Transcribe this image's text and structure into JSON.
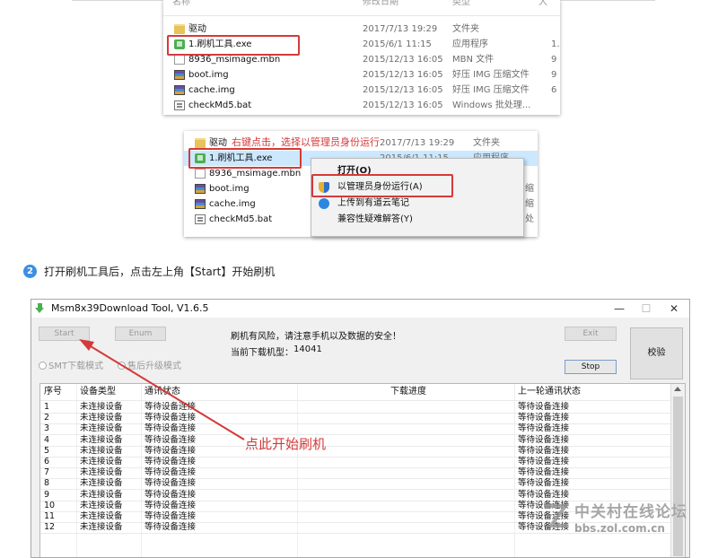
{
  "explorer1": {
    "header": {
      "name": "名称",
      "date": "修改日期",
      "type": "类型",
      "size": "大"
    },
    "rows": [
      {
        "icon": "folder-icon",
        "name": "驱动",
        "date": "2017/7/13 19:29",
        "type": "文件夹",
        "size": ""
      },
      {
        "icon": "exe-icon",
        "name": "1.刷机工具.exe",
        "date": "2015/6/1 11:15",
        "type": "应用程序",
        "size": "1."
      },
      {
        "icon": "file-icon",
        "name": "8936_msimage.mbn",
        "date": "2015/12/13 16:05",
        "type": "MBN 文件",
        "size": "9"
      },
      {
        "icon": "rar-icon",
        "name": "boot.img",
        "date": "2015/12/13 16:05",
        "type": "好压 IMG 压缩文件",
        "size": "9"
      },
      {
        "icon": "rar-icon",
        "name": "cache.img",
        "date": "2015/12/13 16:05",
        "type": "好压 IMG 压缩文件",
        "size": "6"
      },
      {
        "icon": "bat-icon",
        "name": "checkMd5.bat",
        "date": "2015/12/13 16:05",
        "type": "Windows 批处理...",
        "size": ""
      }
    ]
  },
  "explorer2": {
    "annotation": "右键点击，选择以管理员身份运行",
    "rows": [
      {
        "icon": "folder-icon",
        "name": "驱动",
        "date": "2017/7/13 19:29",
        "type": "文件夹"
      },
      {
        "icon": "exe-icon",
        "name": "1.刷机工具.exe",
        "date": "2015/6/1 11:15",
        "type": "应用程序"
      },
      {
        "icon": "file-icon",
        "name": "8936_msimage.mbn",
        "date": "",
        "type": ""
      },
      {
        "icon": "rar-icon",
        "name": "boot.img",
        "date": "",
        "type": "缩"
      },
      {
        "icon": "rar-icon",
        "name": "cache.img",
        "date": "",
        "type": "缩"
      },
      {
        "icon": "bat-icon",
        "name": "checkMd5.bat",
        "date": "",
        "type": "处"
      }
    ],
    "context_menu": [
      {
        "label": "打开(O)",
        "icon": "",
        "bold": true
      },
      {
        "label": "以管理员身份运行(A)",
        "icon": "shield-icon",
        "bold": false
      },
      {
        "label": "上传到有道云笔记",
        "icon": "cloud-icon",
        "bold": false
      },
      {
        "label": "兼容性疑难解答(Y)",
        "icon": "",
        "bold": false
      }
    ]
  },
  "step": {
    "number": "2",
    "text": "打开刷机工具后，点击左上角【Start】开始刷机"
  },
  "tool": {
    "title": "Msm8x39Download Tool, V1.6.5",
    "window_controls": {
      "minimize": "—",
      "maximize": "☐",
      "close": "✕"
    },
    "buttons": {
      "start": "Start",
      "enum": "Enum",
      "exit": "Exit",
      "stop": "Stop",
      "verify": "校验"
    },
    "radios": {
      "smt": "SMT下载模式",
      "aftersale": "售后升级模式"
    },
    "warning": "刷机有风险，请注意手机以及数据的安全！",
    "model_label": "当前下载机型：",
    "model_value": "14041",
    "columns": [
      "序号",
      "设备类型",
      "通讯状态",
      "下载进度",
      "上一轮通讯状态"
    ],
    "rows": [
      [
        "1",
        "未连接设备",
        "等待设备连接",
        "",
        "等待设备连接"
      ],
      [
        "2",
        "未连接设备",
        "等待设备连接",
        "",
        "等待设备连接"
      ],
      [
        "3",
        "未连接设备",
        "等待设备连接",
        "",
        "等待设备连接"
      ],
      [
        "4",
        "未连接设备",
        "等待设备连接",
        "",
        "等待设备连接"
      ],
      [
        "5",
        "未连接设备",
        "等待设备连接",
        "",
        "等待设备连接"
      ],
      [
        "6",
        "未连接设备",
        "等待设备连接",
        "",
        "等待设备连接"
      ],
      [
        "7",
        "未连接设备",
        "等待设备连接",
        "",
        "等待设备连接"
      ],
      [
        "8",
        "未连接设备",
        "等待设备连接",
        "",
        "等待设备连接"
      ],
      [
        "9",
        "未连接设备",
        "等待设备连接",
        "",
        "等待设备连接"
      ],
      [
        "10",
        "未连接设备",
        "等待设备连接",
        "",
        "等待设备连接"
      ],
      [
        "11",
        "未连接设备",
        "等待设备连接",
        "",
        "等待设备连接"
      ],
      [
        "12",
        "未连接设备",
        "等待设备连接",
        "",
        "等待设备连接"
      ]
    ],
    "annotation": "点此开始刷机"
  },
  "watermark": {
    "text": "中关村在线论坛",
    "url": "bbs.zol.com.cn"
  },
  "colors": {
    "annotation_red": "#d43a3a",
    "highlight": "#cce8ff",
    "step_blue": "#3b8fe0"
  }
}
